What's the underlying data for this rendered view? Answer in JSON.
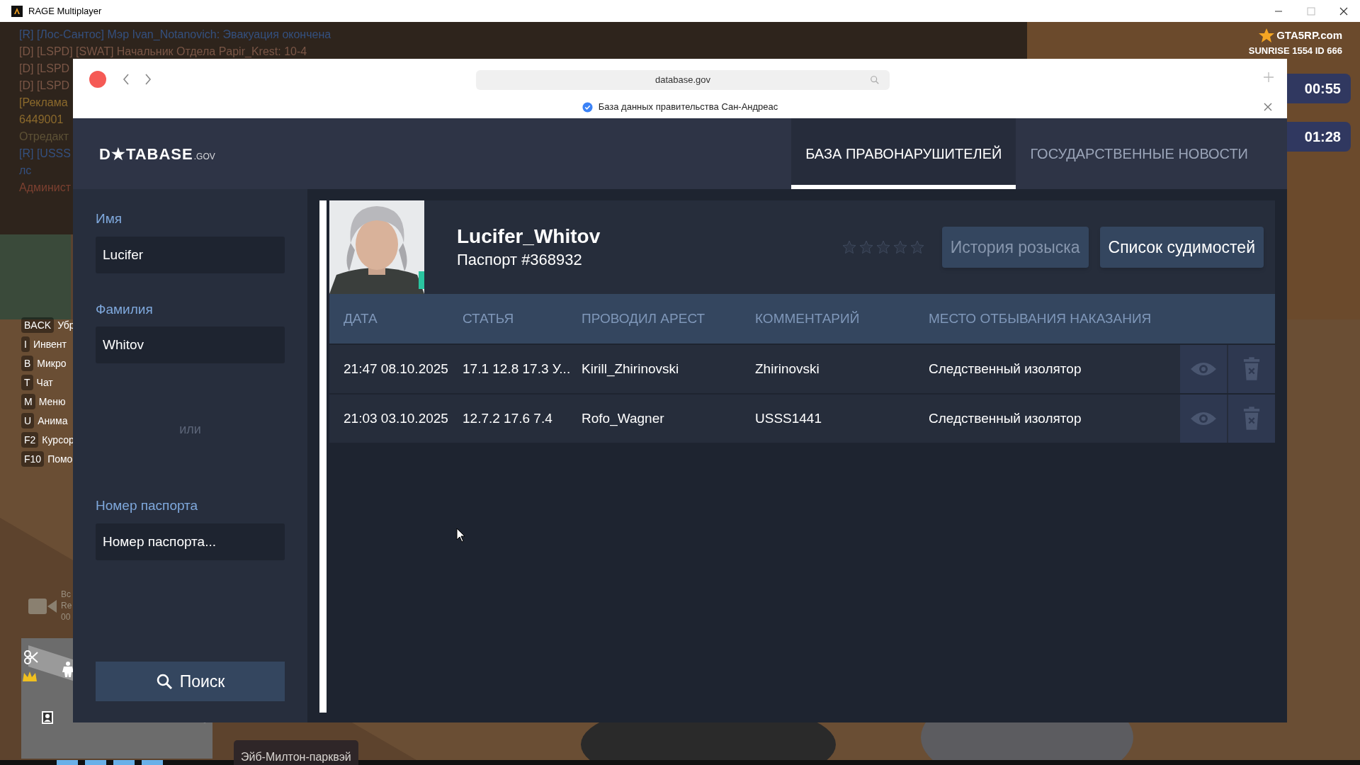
{
  "app_window": {
    "title": "RAGE Multiplayer"
  },
  "game_hud": {
    "chat": [
      {
        "text": "[R] [Лос-Сантос] Мэр Ivan_Notanovich: Эвакуация окончена",
        "color": "#34507f"
      },
      {
        "text": "[D] [LSPD] [SWAT] Начальник Отдела Papir_Krest: 10-4",
        "color": "#7a5646"
      },
      {
        "text": "[D] [LSPD",
        "color": "#7a5646"
      },
      {
        "text": "[D] [LSPD",
        "color": "#7a5646"
      },
      {
        "text": "[Реклама",
        "color": "#8c6a2c"
      },
      {
        "text": "6449001",
        "color": "#8c6a2c"
      },
      {
        "text": "Отредакт",
        "color": "#5e5236"
      },
      {
        "text": "[R] [USSS",
        "color": "#34507f"
      },
      {
        "text": "лс",
        "color": "#34507f"
      },
      {
        "text": "Админист",
        "color": "#7c4030"
      }
    ],
    "hotkeys": [
      {
        "key": "BACK",
        "label": "Убр"
      },
      {
        "key": "I",
        "label": "Инвент"
      },
      {
        "key": "B",
        "label": "Микро"
      },
      {
        "key": "T",
        "label": "Чат"
      },
      {
        "key": "M",
        "label": "Меню"
      },
      {
        "key": "U",
        "label": "Анима"
      },
      {
        "key": "F2",
        "label": "Курсор"
      },
      {
        "key": "F10",
        "label": "Помо"
      }
    ],
    "server": {
      "logo": "GTA5RP.com",
      "info": "SUNRISE 1554 ID 666"
    },
    "timers": [
      "00:55",
      "01:28"
    ],
    "recording": [
      "Вс",
      "Re",
      "00"
    ],
    "location": "Эйб-Милтон-парквэй"
  },
  "browser": {
    "url": "database.gov",
    "notice": "База данных правительства Сан-Андреас"
  },
  "site": {
    "logo": {
      "main": "D★TABASE",
      "suffix": ".GOV"
    },
    "tabs": [
      {
        "label": "БАЗА ПРАВОНАРУШИТЕЛЕЙ",
        "selected": true
      },
      {
        "label": "ГОСУДАРСТВЕННЫЕ НОВОСТИ",
        "selected": false
      }
    ],
    "search_form": {
      "fields": [
        {
          "label": "Имя",
          "value": "Lucifer"
        },
        {
          "label": "Фамилия",
          "value": "Whitov"
        },
        {
          "label": "Номер паспорта",
          "placeholder": "Номер паспорта..."
        }
      ],
      "separator": "или",
      "button": "Поиск"
    },
    "profile": {
      "name": "Lucifer_Whitov",
      "passport": "Паспорт #368932",
      "stars": 0,
      "buttons": [
        {
          "label": "История розыска",
          "disabled": true
        },
        {
          "label": "Список судимостей",
          "disabled": false
        }
      ]
    },
    "table": {
      "columns": [
        "ДАТА",
        "СТАТЬЯ",
        "ПРОВОДИЛ АРЕСТ",
        "КОММЕНТАРИЙ",
        "МЕСТО ОТБЫВАНИЯ НАКАЗАНИЯ"
      ],
      "rows": [
        {
          "cells": [
            "21:47 08.10.2025",
            "17.1 12.8 17.3 У...",
            "Kirill_Zhirinovski",
            "Zhirinovski",
            "Следственный изолятор"
          ]
        },
        {
          "cells": [
            "21:03 03.10.2025",
            "12.7.2 17.6 7.4",
            "Rofo_Wagner",
            "USSS1441",
            "Следственный изолятор"
          ]
        }
      ]
    }
  }
}
